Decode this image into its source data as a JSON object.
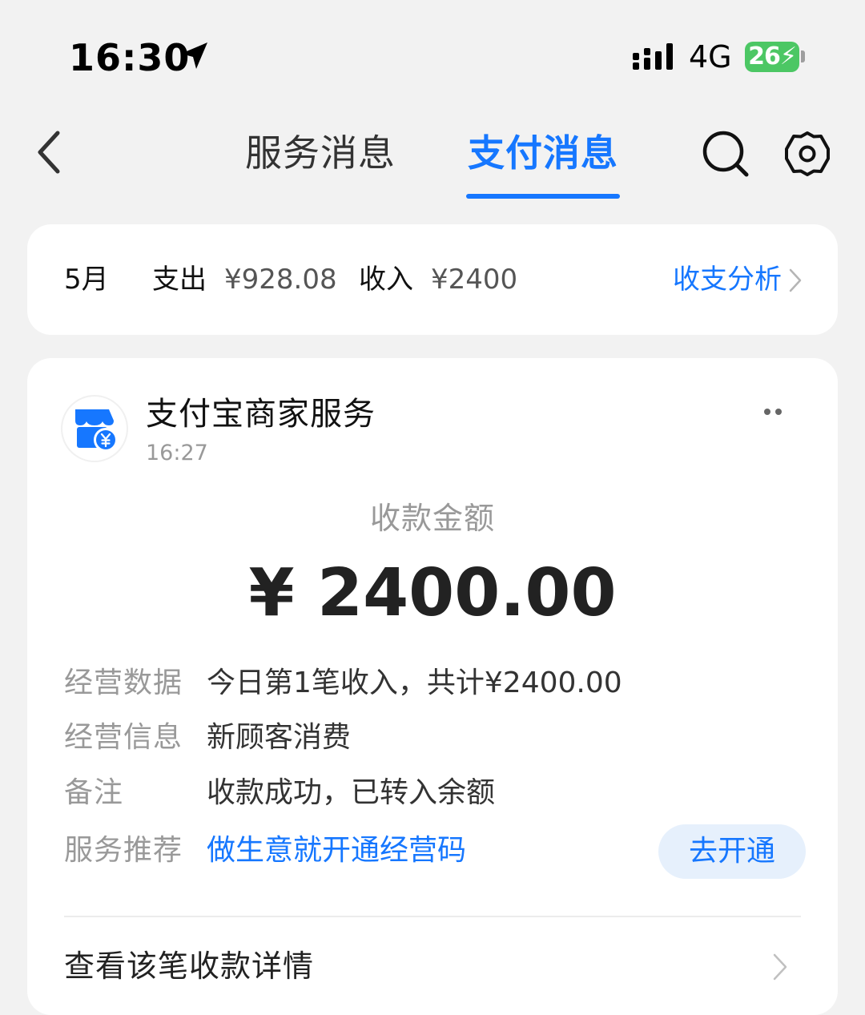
{
  "status_bar": {
    "time": "16:30",
    "network": "4G",
    "battery": "26",
    "icons": [
      "location-arrow-icon",
      "signal-icon",
      "charging-icon"
    ]
  },
  "nav": {
    "back_icon": "chevron-left-icon",
    "tabs": [
      {
        "label": "服务消息",
        "active": false
      },
      {
        "label": "支付消息",
        "active": true
      }
    ],
    "search_icon": "search-icon",
    "settings_icon": "gear-icon"
  },
  "summary": {
    "month": "5月",
    "expense_label": "支出",
    "expense_value": "¥928.08",
    "income_label": "收入",
    "income_value": "¥2400",
    "analysis_link": "收支分析"
  },
  "message": {
    "merchant_name": "支付宝商家服务",
    "time": "16:27",
    "amount_label": "收款金额",
    "amount": "¥ 2400.00",
    "details": [
      {
        "label": "经营数据",
        "value": "今日第1笔收入，共计¥2400.00"
      },
      {
        "label": "经营信息",
        "value": "新顾客消费"
      },
      {
        "label": "备注",
        "value": "收款成功，已转入余额"
      },
      {
        "label": "服务推荐",
        "value": "做生意就开通经营码"
      }
    ],
    "action_button": "去开通",
    "view_details": "查看该笔收款详情"
  },
  "colors": {
    "accent": "#1677ff",
    "background": "#f2f2f2",
    "card": "#ffffff",
    "battery": "#4cc764",
    "button_bg": "#e6f0fc"
  }
}
